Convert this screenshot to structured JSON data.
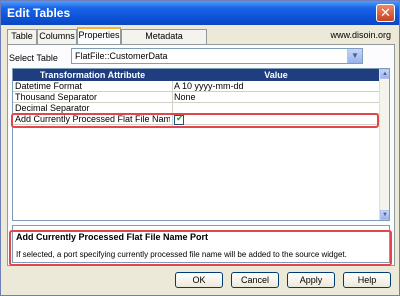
{
  "window": {
    "title": "Edit Tables",
    "close_glyph": "✕"
  },
  "tabs": [
    {
      "label": "Table"
    },
    {
      "label": "Columns"
    },
    {
      "label": "Properties"
    },
    {
      "label": "Metadata Extensions"
    }
  ],
  "site_text": "www.disoin.org",
  "select_table": {
    "label": "Select Table",
    "value": "FlatFile::CustomerData"
  },
  "grid": {
    "headers": [
      "Transformation Attribute",
      "Value"
    ],
    "rows": [
      {
        "attribute": "Datetime Format",
        "value": "A  10 yyyy-mm-dd"
      },
      {
        "attribute": "Thousand Separator",
        "value": "None"
      },
      {
        "attribute": "Decimal Separator",
        "value": ""
      },
      {
        "attribute": "Add Currently Processed Flat File Name Port",
        "value": "",
        "checked": true
      }
    ]
  },
  "description": {
    "title": "Add Currently Processed Flat File Name Port",
    "text": "If selected, a port specifying currently processed file name will be added to the source widget."
  },
  "buttons": {
    "ok": "OK",
    "cancel": "Cancel",
    "apply": "Apply",
    "help": "Help"
  },
  "colors": {
    "highlight": "#e0474c",
    "title_bar": "#0c52d8",
    "grid_header": "#1f3e7f"
  }
}
